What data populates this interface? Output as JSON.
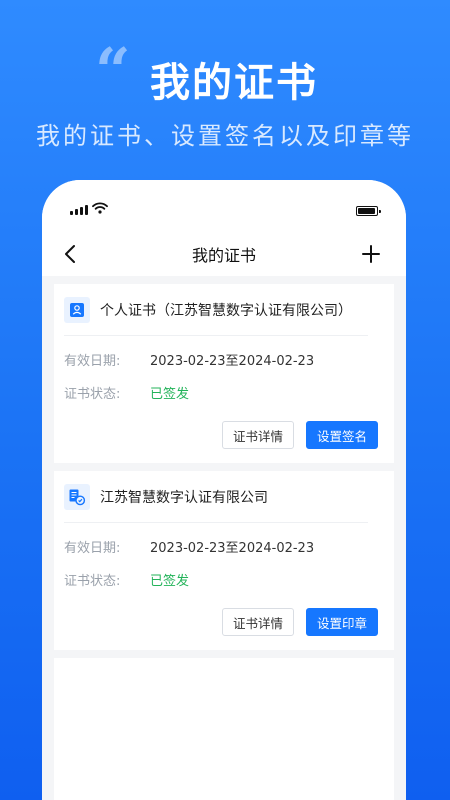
{
  "hero": {
    "quote_glyph": "“",
    "title": "我的证书",
    "subtitle": "我的证书、设置签名以及印章等"
  },
  "nav": {
    "title": "我的证书",
    "back_icon": "chevron-left-icon",
    "add_icon": "plus-icon"
  },
  "cards": [
    {
      "icon": "person-certificate-icon",
      "title": "个人证书（江苏智慧数字认证有限公司）",
      "validity_label": "有效日期:",
      "validity_value": "2023-02-23至2024-02-23",
      "status_label": "证书状态:",
      "status_value": "已签发",
      "detail_label": "证书详情",
      "action_label": "设置签名"
    },
    {
      "icon": "enterprise-certificate-icon",
      "title": "江苏智慧数字认证有限公司",
      "validity_label": "有效日期:",
      "validity_value": "2023-02-23至2024-02-23",
      "status_label": "证书状态:",
      "status_value": "已签发",
      "detail_label": "证书详情",
      "action_label": "设置印章"
    }
  ],
  "colors": {
    "primary": "#1677ff",
    "status_ok": "#23b35a",
    "background_top": "#2f8bff",
    "background_bottom": "#0f5ff0"
  }
}
